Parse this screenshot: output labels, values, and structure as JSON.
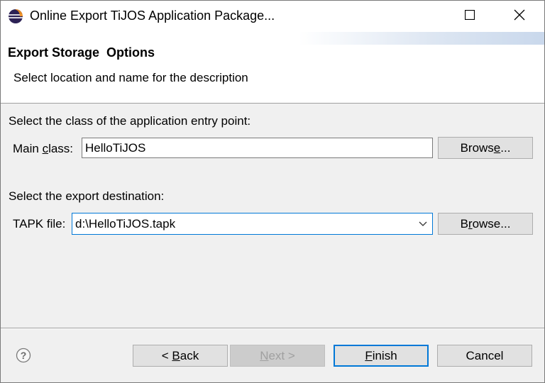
{
  "window": {
    "title": "Online Export TiJOS Application Package...",
    "icons": {
      "app": "eclipse-icon",
      "maximize": "maximize-icon",
      "close": "close-icon"
    }
  },
  "banner": {
    "title": "Export Storage  Options",
    "description": "Select location and name for the description"
  },
  "main_class_section": {
    "heading": "Select the class of the application entry point:",
    "label_pre": "Main ",
    "label_mnemonic": "c",
    "label_post": "lass:",
    "value": "HelloTiJOS",
    "browse_pre": "Brows",
    "browse_mnemonic": "e",
    "browse_post": "..."
  },
  "destination_section": {
    "heading": "Select the export destination:",
    "label": "TAPK file:",
    "value": "d:\\HelloTiJOS.tapk",
    "browse_pre": "B",
    "browse_mnemonic": "r",
    "browse_post": "owse..."
  },
  "footer": {
    "help_icon": "help-icon",
    "back_pre": "< ",
    "back_mnemonic": "B",
    "back_post": "ack",
    "next_pre": "",
    "next_mnemonic": "N",
    "next_post": "ext >",
    "finish_pre": "",
    "finish_mnemonic": "F",
    "finish_post": "inish",
    "cancel": "Cancel"
  },
  "colors": {
    "focus_accent": "#0078d7",
    "dialog_bg": "#f0f0f0",
    "button_bg": "#e1e1e1",
    "disabled_text": "#a0a0a0"
  }
}
